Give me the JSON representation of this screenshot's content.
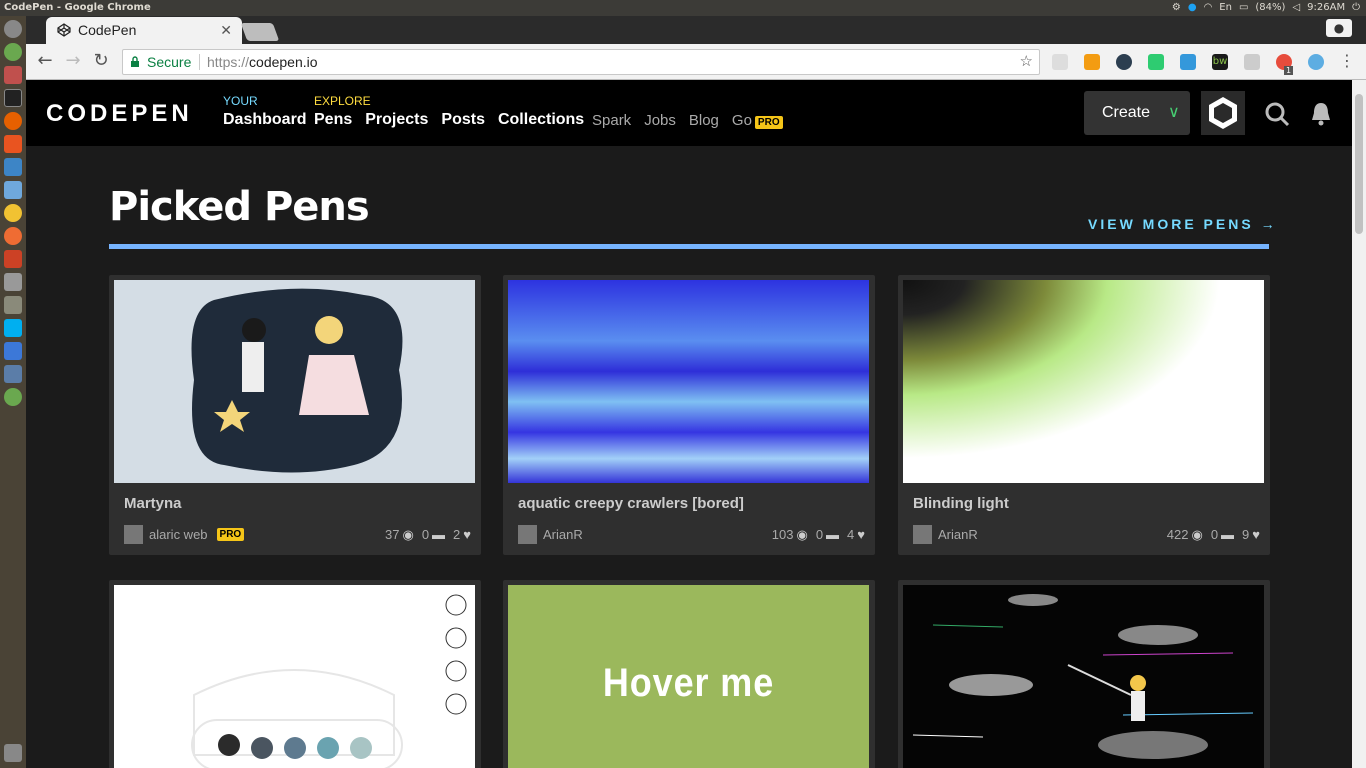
{
  "os": {
    "window_title": "CodePen - Google Chrome",
    "indicators": [
      "En",
      "(84%)",
      "9:26AM"
    ]
  },
  "browser": {
    "tab_title": "CodePen",
    "secure_label": "Secure",
    "url_scheme": "https://",
    "url_host": "codepen.io",
    "ext_badge": "1"
  },
  "header": {
    "logo": "CODEPEN",
    "your_label": "YOUR",
    "dashboard": "Dashboard",
    "explore_label": "EXPLORE",
    "explore_links": [
      "Pens",
      "Projects",
      "Posts",
      "Collections"
    ],
    "secondary_links": [
      "Spark",
      "Jobs",
      "Blog",
      "Go"
    ],
    "go_badge": "PRO",
    "create_label": "Create"
  },
  "section": {
    "title": "Picked Pens",
    "view_more": "VIEW MORE PENS →"
  },
  "pens": [
    {
      "title": "Martyna",
      "author": "alaric web",
      "pro": "PRO",
      "views": "37",
      "comments": "0",
      "likes": "2"
    },
    {
      "title": "aquatic creepy crawlers [bored]",
      "author": "ArianR",
      "pro": "",
      "views": "103",
      "comments": "0",
      "likes": "4"
    },
    {
      "title": "Blinding light",
      "author": "ArianR",
      "pro": "",
      "views": "422",
      "comments": "0",
      "likes": "9"
    },
    {
      "title": "",
      "author": "",
      "pro": "",
      "views": "",
      "comments": "",
      "likes": ""
    },
    {
      "title": "",
      "author": "",
      "pro": "",
      "views": "",
      "comments": "",
      "likes": "",
      "preview_text": "Hover me"
    },
    {
      "title": "",
      "author": "",
      "pro": "",
      "views": "",
      "comments": "",
      "likes": ""
    }
  ],
  "colors": {
    "accent_rule": "#76b4ff",
    "view_more": "#76daff",
    "pro_badge": "#f5c518",
    "create_chevron": "#47cf73"
  }
}
